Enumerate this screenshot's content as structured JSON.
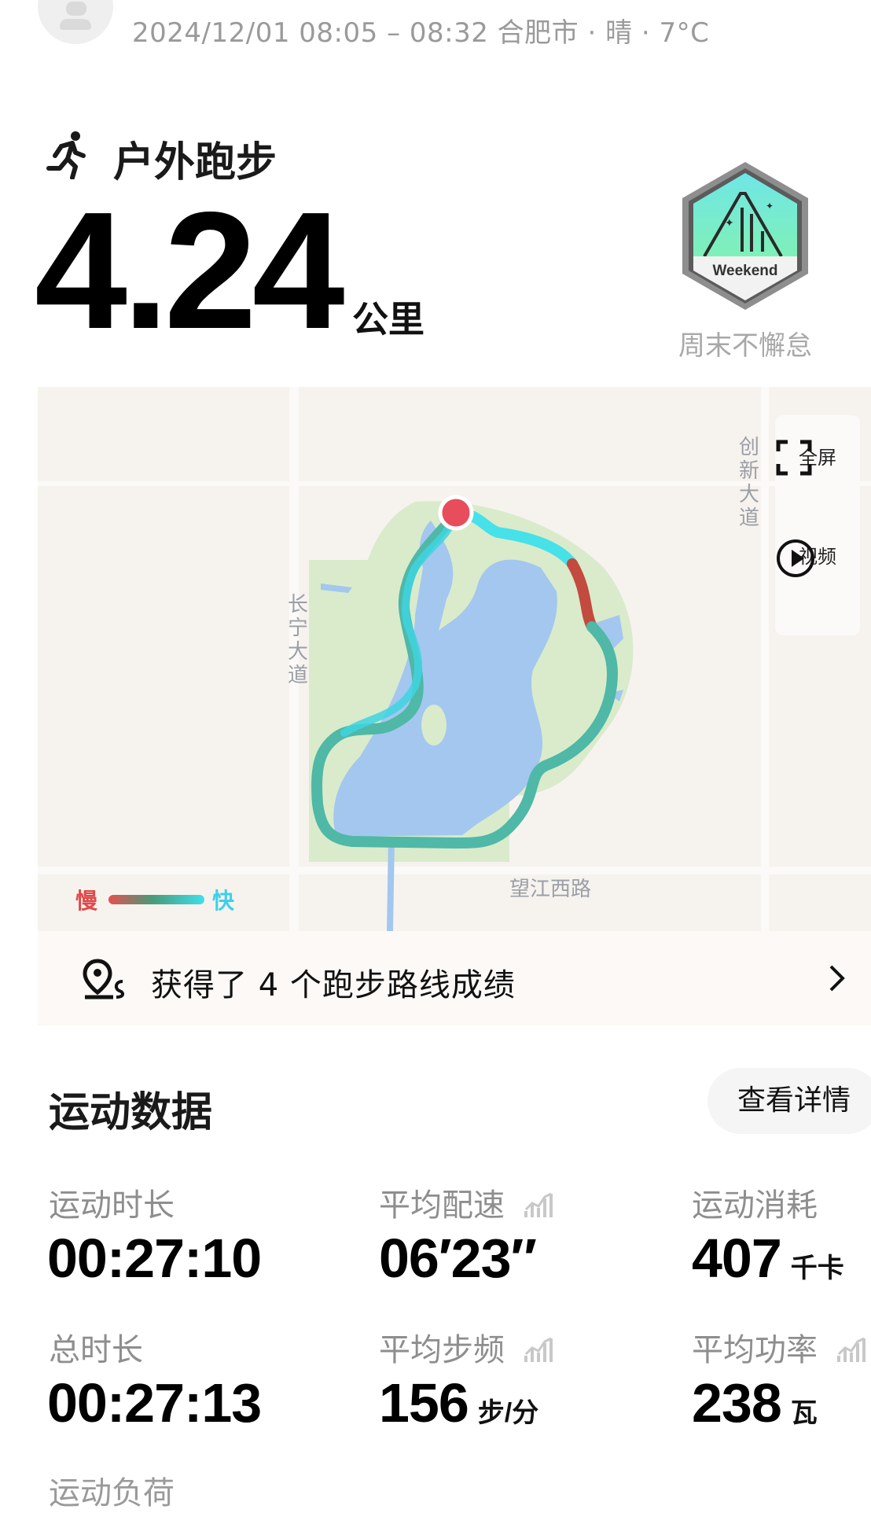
{
  "header": {
    "meta": "2024/12/01 08:05 – 08:32 合肥市 · 晴 · 7°C"
  },
  "activity": {
    "type": "户外跑步",
    "distance": "4.24",
    "distance_unit": "公里",
    "badge_text": "Weekend",
    "badge_label": "周末不懈怠"
  },
  "map": {
    "controls": {
      "fullscreen_label": "全屏",
      "video_label": "视频"
    },
    "roads": {
      "north_east": "创新大道",
      "west": "长宁大道",
      "south": "望江西路"
    },
    "legend": {
      "slow": "慢",
      "fast": "快"
    },
    "colors": {
      "route_fast": "#3ee0ea",
      "route_mid": "#4fb896",
      "route_slow": "#c24a3e",
      "water": "#a3c7ee",
      "park": "#d9ebcb",
      "start_marker": "#e84d5b"
    }
  },
  "achievements": {
    "text": "获得了 4 个跑步路线成绩"
  },
  "stats": {
    "section_title": "运动数据",
    "details_button": "查看详情",
    "items": [
      {
        "label": "运动时长",
        "value": "00:27:10",
        "unit": ""
      },
      {
        "label": "平均配速",
        "value": "06′23″",
        "unit": ""
      },
      {
        "label": "运动消耗",
        "value": "407",
        "unit": "千卡"
      },
      {
        "label": "总时长",
        "value": "00:27:13",
        "unit": ""
      },
      {
        "label": "平均步频",
        "value": "156",
        "unit": "步/分"
      },
      {
        "label": "平均功率",
        "value": "238",
        "unit": "瓦"
      }
    ],
    "cut_off_label": "运动负荷"
  }
}
